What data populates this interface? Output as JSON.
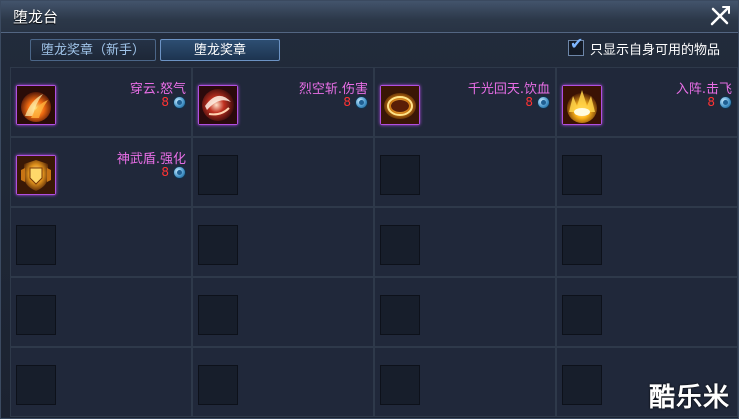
{
  "window": {
    "title": "堕龙台"
  },
  "tabs": [
    {
      "label": "堕龙奖章（新手）",
      "active": false
    },
    {
      "label": "堕龙奖章",
      "active": true
    }
  ],
  "filter": {
    "label": "只显示自身可用的物品",
    "checked": true
  },
  "colors": {
    "item_name": "#e86ee6",
    "item_count": "#ff3333",
    "icon_frame": "#b04fe0"
  },
  "items": [
    {
      "name": "穿云.怒气",
      "count": "8",
      "icon": "flame-claw-icon"
    },
    {
      "name": "烈空斩.伤害",
      "count": "8",
      "icon": "crescent-slash-icon"
    },
    {
      "name": "千光回天.饮血",
      "count": "8",
      "icon": "golden-ring-icon"
    },
    {
      "name": "入阵.击飞",
      "count": "8",
      "icon": "fire-burst-icon"
    },
    {
      "name": "神武盾.强化",
      "count": "8",
      "icon": "golden-shield-icon"
    }
  ],
  "empty_slots": 15,
  "watermark": "酷乐米"
}
